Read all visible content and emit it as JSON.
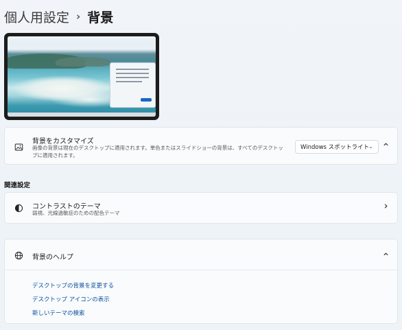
{
  "breadcrumb": {
    "parent": "個人用設定",
    "separator": "›",
    "current": "背景"
  },
  "background_row": {
    "title": "背景をカスタマイズ",
    "description": "画像の背景は現在のデスクトップに適用されます。単色またはスライドショーの背景は、すべてのデスクトップに適用されます。",
    "select_value": "Windows スポットライト",
    "icon": "image-icon",
    "expanded": true
  },
  "related": {
    "heading": "関連設定",
    "contrast": {
      "title": "コントラストのテーマ",
      "description": "弱視、光線過敏症のための配色テーマ",
      "icon": "contrast-icon"
    }
  },
  "help": {
    "title": "背景のヘルプ",
    "icon": "globe-icon",
    "links": [
      "デスクトップの背景を変更する",
      "デスクトップ アイコンの表示",
      "新しいテーマの検索"
    ]
  },
  "colors": {
    "accent": "#1b66c9",
    "link": "#0b4f9c"
  }
}
